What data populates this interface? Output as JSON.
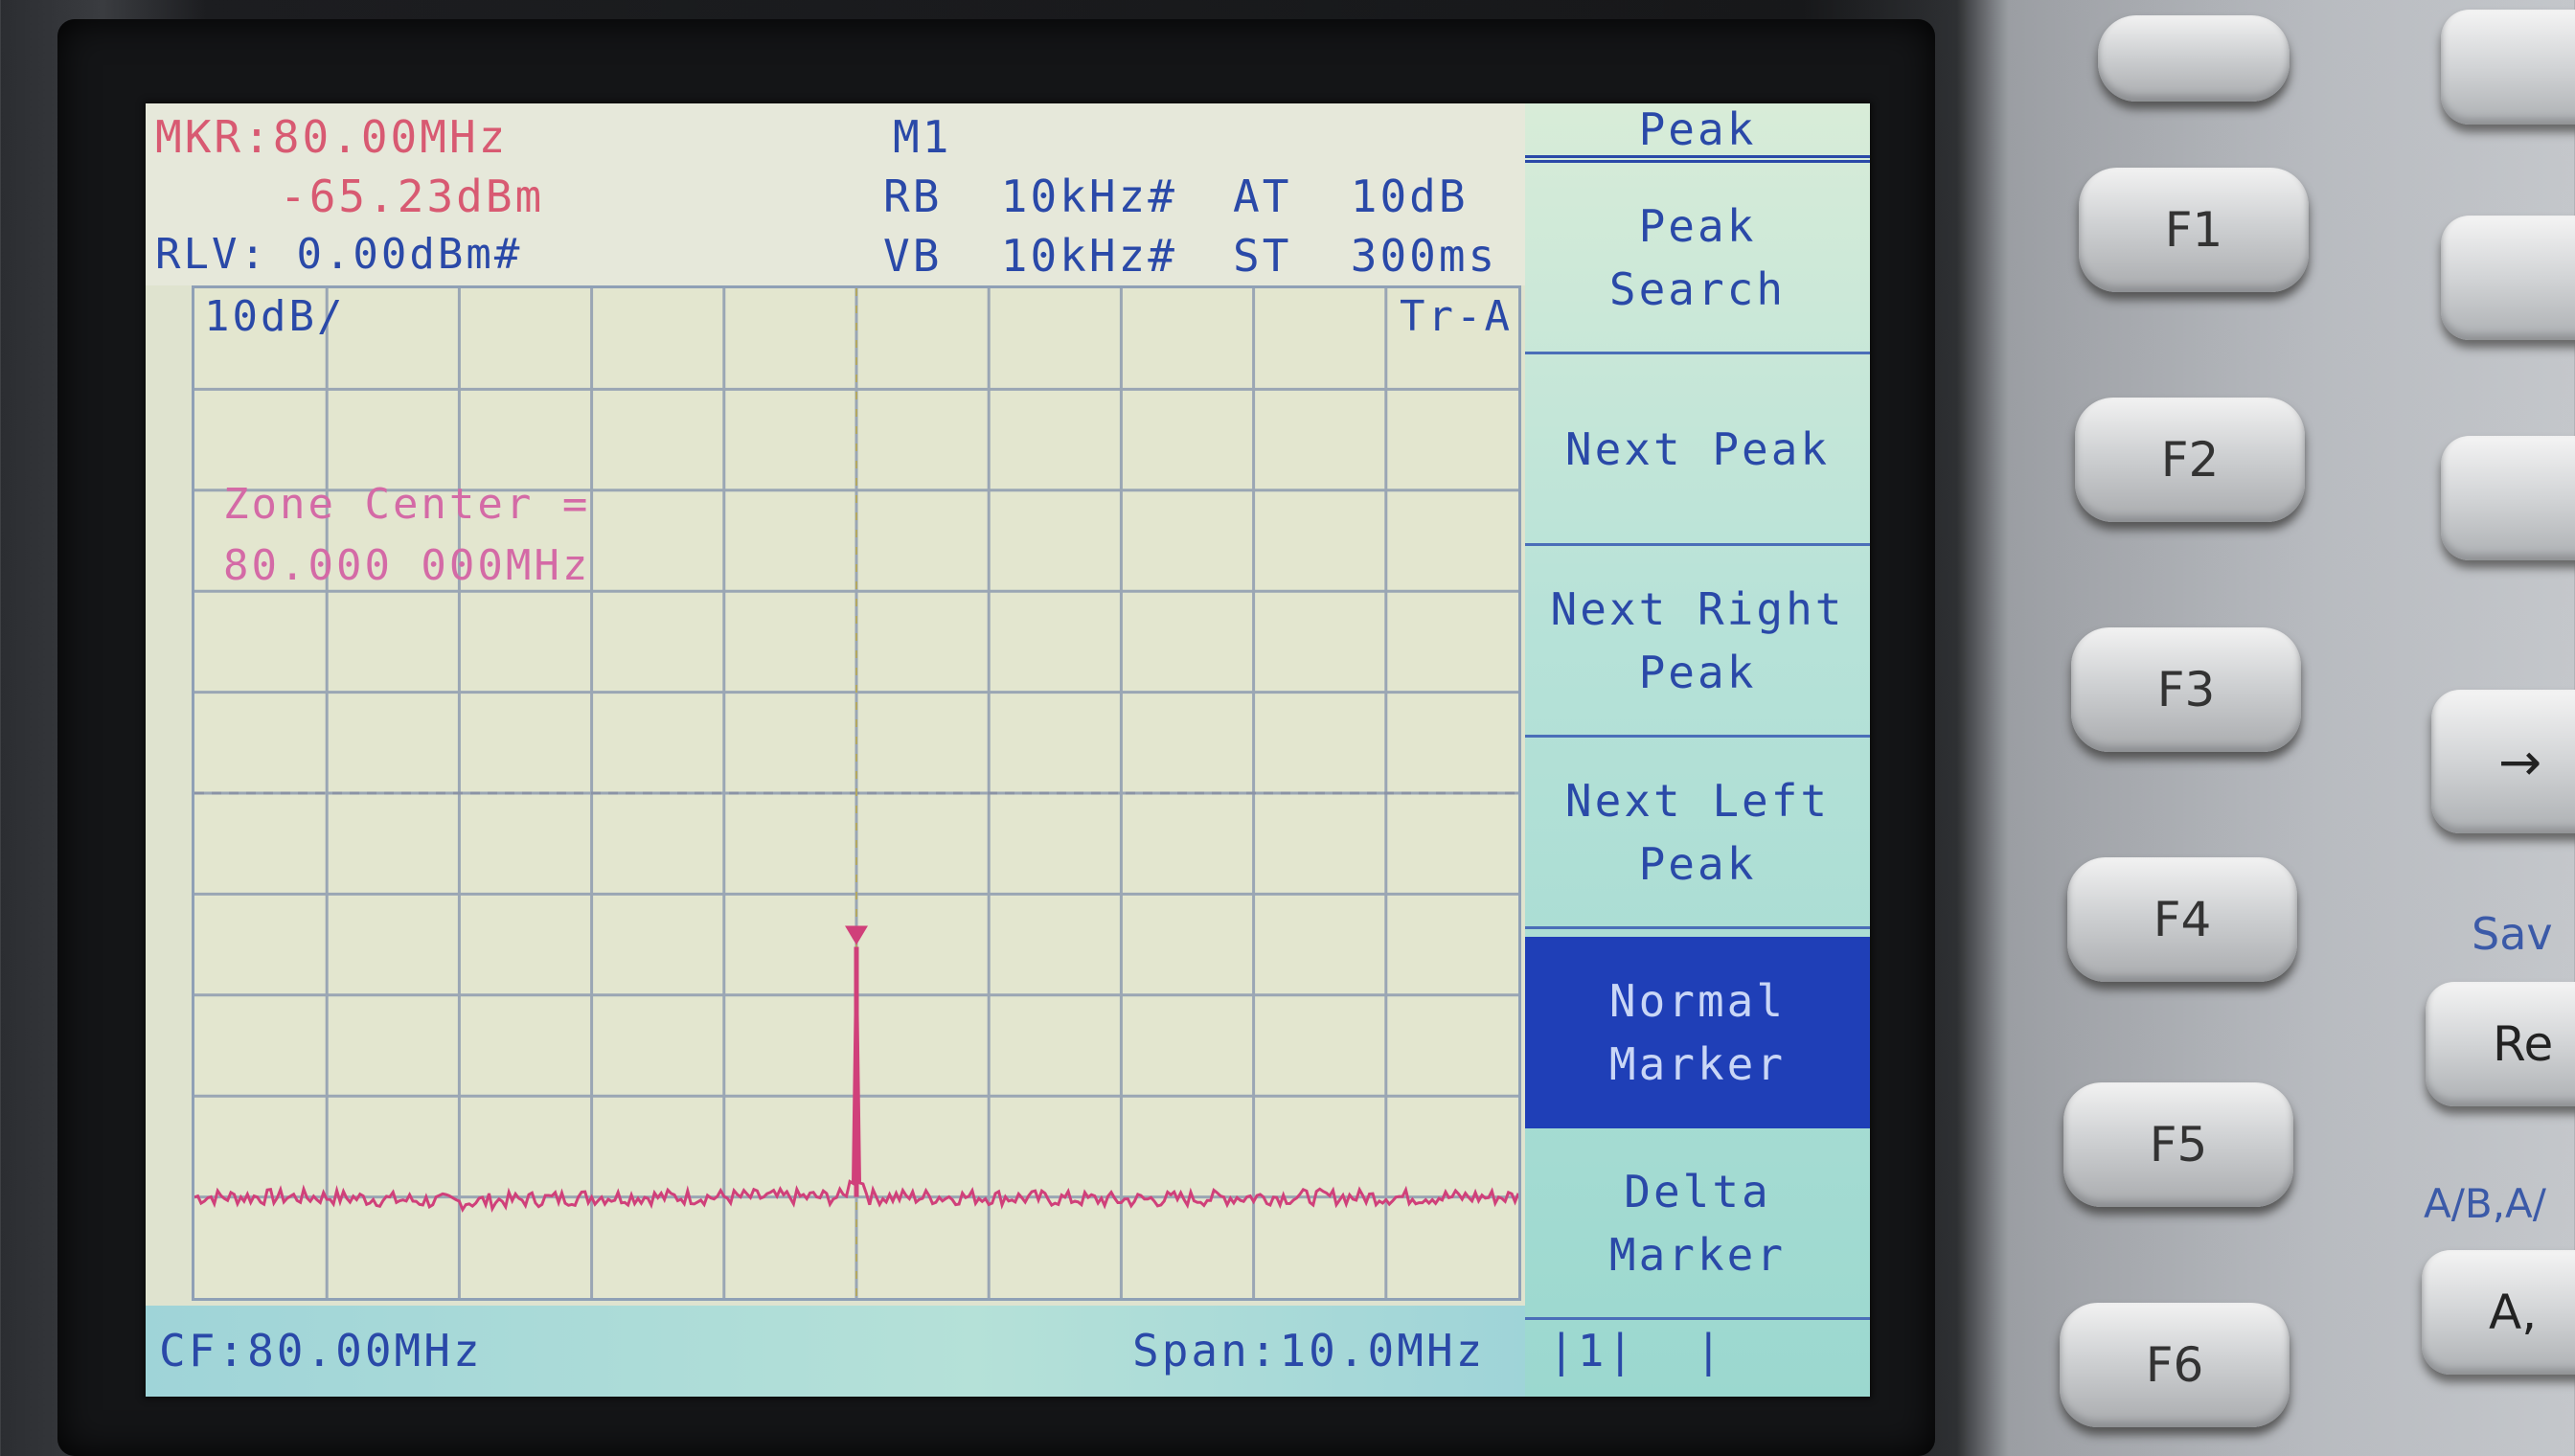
{
  "header": {
    "marker_freq": "MKR:80.00MHz",
    "marker_level": "-65.23dBm",
    "ref_level": "RLV: 0.00dBm#",
    "marker_id": "M1",
    "rbw": "RB  10kHz#",
    "vbw": "VB  10kHz#",
    "atten": "AT  10dB",
    "sweep": "ST  300ms"
  },
  "display": {
    "scale": "10dB/",
    "trace": "Tr-A",
    "zone_line1": "Zone Center =",
    "zone_line2": "80.000 000MHz"
  },
  "footer": {
    "center_freq": "CF:80.00MHz",
    "span": "Span:10.0MHz",
    "status": "|1|  |"
  },
  "softkeys": {
    "title": "Peak",
    "items": [
      {
        "line1": "Peak",
        "line2": "Search"
      },
      {
        "line1": "Next Peak",
        "line2": ""
      },
      {
        "line1": "Next Right",
        "line2": "Peak"
      },
      {
        "line1": "Next Left",
        "line2": "Peak"
      },
      {
        "line1": "Normal",
        "line2": "Marker"
      },
      {
        "line1": "Delta",
        "line2": "Marker"
      }
    ]
  },
  "function_keys": [
    "F1",
    "F2",
    "F3",
    "F4",
    "F5",
    "F6"
  ],
  "right_panel": {
    "save_label": "Sav",
    "recall_key": "Re",
    "ab_label": "A/B,A/",
    "ab_key": "A,"
  },
  "colors": {
    "trace": "#d0407a",
    "softkey_active": "#1f3fb7",
    "text_blue": "#2a49a8",
    "marker_text": "#d85a72"
  },
  "chart_data": {
    "type": "line",
    "title": "",
    "xlabel": "",
    "ylabel": "",
    "center_freq_mhz": 80.0,
    "span_mhz": 10.0,
    "ref_level_dbm": 0.0,
    "scale_db_per_div": 10,
    "ylim": [
      -100,
      0
    ],
    "xlim": [
      75.0,
      85.0
    ],
    "grid": true,
    "series": [
      {
        "x": [
          75.0,
          76.0,
          77.0,
          78.0,
          79.0,
          79.9,
          79.98,
          80.0,
          80.02,
          80.1,
          81.0,
          82.0,
          83.0,
          84.0,
          85.0
        ],
        "y": [
          -90,
          -90,
          -90.5,
          -90,
          -90,
          -90,
          -88,
          -65.23,
          -88,
          -90,
          -90,
          -90.3,
          -90,
          -90,
          -90
        ]
      }
    ],
    "marker": {
      "x": 80.0,
      "y": -65.23,
      "label": "M1"
    },
    "display_line_dbm": -50
  }
}
